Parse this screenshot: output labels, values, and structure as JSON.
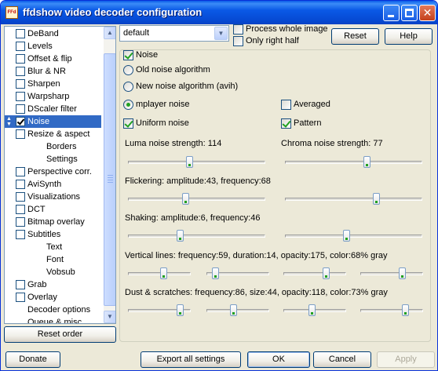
{
  "window": {
    "title": "ffdshow video decoder configuration",
    "icon_text": "ffdshow"
  },
  "titlebar_buttons": {
    "minimize": "minimize",
    "maximize": "maximize",
    "close": "✕"
  },
  "tree": {
    "items": [
      {
        "label": "DeBand",
        "checked": false,
        "kind": "check"
      },
      {
        "label": "Levels",
        "checked": false,
        "kind": "check"
      },
      {
        "label": "Offset & flip",
        "checked": false,
        "kind": "check"
      },
      {
        "label": "Blur & NR",
        "checked": false,
        "kind": "check"
      },
      {
        "label": "Sharpen",
        "checked": false,
        "kind": "check"
      },
      {
        "label": "Warpsharp",
        "checked": false,
        "kind": "check"
      },
      {
        "label": "DScaler filter",
        "checked": false,
        "kind": "check"
      },
      {
        "label": "Noise",
        "checked": true,
        "kind": "check",
        "selected": true
      },
      {
        "label": "Resize & aspect",
        "checked": false,
        "kind": "check"
      },
      {
        "label": "Borders",
        "kind": "sub"
      },
      {
        "label": "Settings",
        "kind": "sub"
      },
      {
        "label": "Perspective corr.",
        "checked": false,
        "kind": "check"
      },
      {
        "label": "AviSynth",
        "checked": false,
        "kind": "check"
      },
      {
        "label": "Visualizations",
        "checked": false,
        "kind": "check"
      },
      {
        "label": "DCT",
        "checked": false,
        "kind": "check"
      },
      {
        "label": "Bitmap overlay",
        "checked": false,
        "kind": "check"
      },
      {
        "label": "Subtitles",
        "checked": false,
        "kind": "check"
      },
      {
        "label": "Text",
        "kind": "sub"
      },
      {
        "label": "Font",
        "kind": "sub"
      },
      {
        "label": "Vobsub",
        "kind": "sub"
      },
      {
        "label": "Grab",
        "checked": false,
        "kind": "check"
      },
      {
        "label": "Overlay",
        "checked": false,
        "kind": "check"
      },
      {
        "label": "Decoder options",
        "kind": "plain"
      },
      {
        "label": "Queue & misc",
        "kind": "plain"
      }
    ]
  },
  "reset_order_label": "Reset order",
  "preset": {
    "value": "default"
  },
  "process_whole_image": {
    "label": "Process whole image",
    "checked": false
  },
  "only_right_half": {
    "label": "Only right half",
    "checked": false
  },
  "reset_label": "Reset",
  "help_label": "Help",
  "noise": {
    "enable_label": "Noise",
    "enabled": true,
    "old_algo_label": "Old noise algorithm",
    "old_algo_selected": false,
    "new_algo_label": "New noise algorithm (avih)",
    "new_algo_selected": false,
    "mplayer_label": "mplayer noise",
    "mplayer_selected": true,
    "averaged_label": "Averaged",
    "averaged_checked": false,
    "uniform_label": "Uniform noise",
    "uniform_checked": true,
    "pattern_label": "Pattern",
    "pattern_checked": true,
    "luma_label": "Luma noise strength: 114",
    "luma_value": 0.45,
    "chroma_label": "Chroma noise strength: 77",
    "chroma_value": 0.6,
    "flicker_label": "Flickering: amplitude:43, frequency:68",
    "flicker_amp": 0.42,
    "flicker_freq": 0.67,
    "shaking_label": "Shaking: amplitude:6, frequency:46",
    "shaking_amp": 0.38,
    "shaking_freq": 0.45,
    "vlines_label": "Vertical lines: frequency:59, duration:14, opacity:175, color:68% gray",
    "vlines_values": [
      0.58,
      0.14,
      0.69,
      0.68
    ],
    "dust_label": "Dust & scratches: frequency:86, size:44, opacity:118, color:73% gray",
    "dust_values": [
      0.84,
      0.44,
      0.46,
      0.73
    ]
  },
  "bottom": {
    "donate": "Donate",
    "export": "Export all settings",
    "ok": "OK",
    "cancel": "Cancel",
    "apply": "Apply"
  }
}
